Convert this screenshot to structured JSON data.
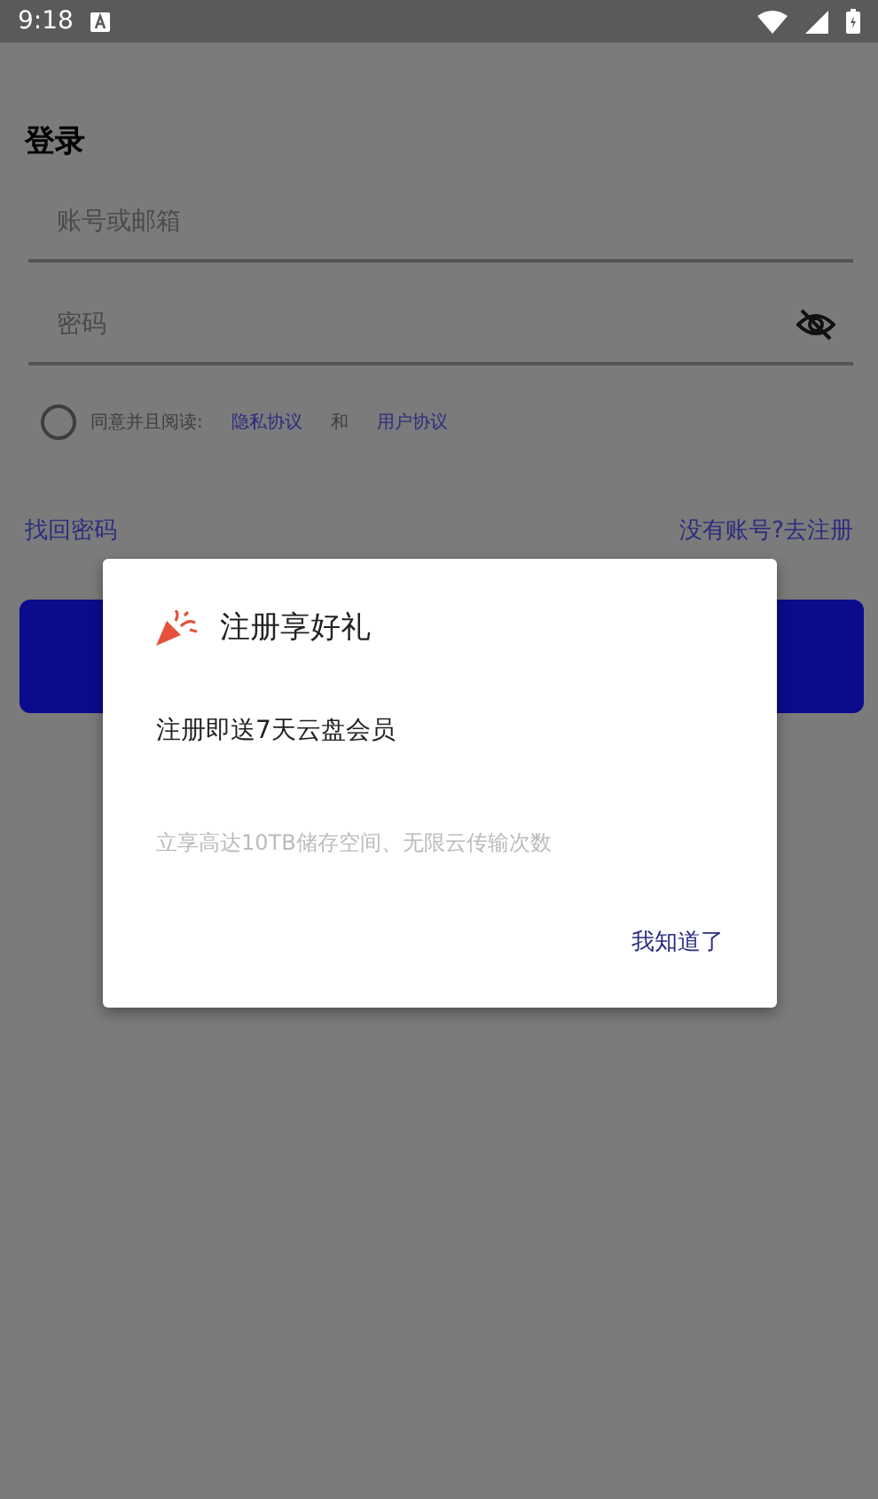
{
  "status_bar": {
    "time": "9:18"
  },
  "title": "登录",
  "fields": [
    {
      "placeholder": "账号或邮箱",
      "kind": "text"
    },
    {
      "placeholder": "密码",
      "kind": "password"
    }
  ],
  "agreement": {
    "checked": false,
    "text": "同意并且阅读:",
    "links": [
      "隐私协议",
      "用户协议"
    ],
    "joiner": "和"
  },
  "links": {
    "forgot": "找回密码",
    "register": "没有账号?去注册"
  },
  "dialog": {
    "title": "注册享好礼",
    "message": "注册即送7天云盘会员",
    "detail": "立享高达10TB储存空间、无限云传输次数",
    "button": "我知道了"
  }
}
